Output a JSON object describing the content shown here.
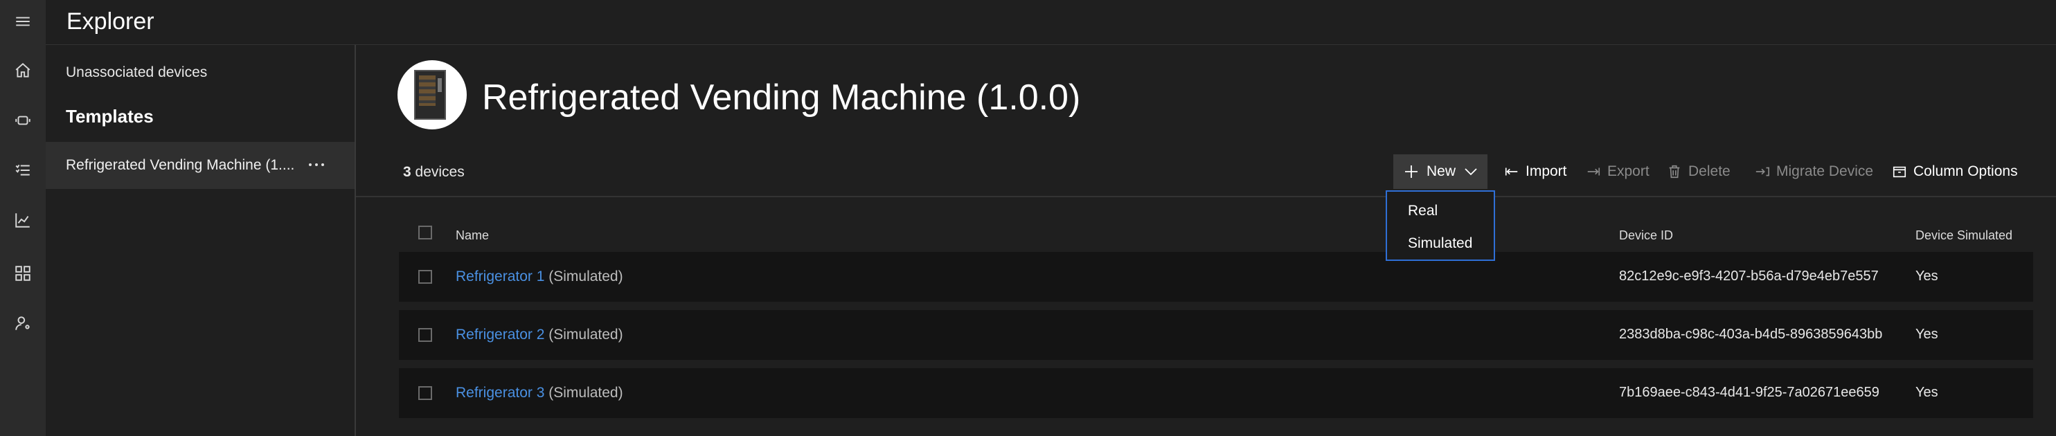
{
  "app": {
    "title": "Explorer"
  },
  "rail": {
    "icons": [
      "menu-icon",
      "home-icon",
      "device-icon",
      "checklist-icon",
      "chart-icon",
      "dashboard-icon",
      "user-settings-icon"
    ]
  },
  "nav": {
    "unassociated_label": "Unassociated devices",
    "templates_heading": "Templates",
    "selected_template": "Refrigerated Vending Machine (1...."
  },
  "header": {
    "title": "Refrigerated Vending Machine (1.0.0)"
  },
  "toolbar": {
    "count": "3",
    "count_suffix": " devices",
    "new_label": "New",
    "import_label": "Import",
    "export_label": "Export",
    "delete_label": "Delete",
    "migrate_label": "Migrate Device",
    "column_options_label": "Column Options"
  },
  "new_menu": {
    "items": [
      "Real",
      "Simulated"
    ]
  },
  "table": {
    "columns": {
      "name": "Name",
      "device_id": "Device ID",
      "simulated": "Device Simulated"
    },
    "rows": [
      {
        "name": "Refrigerator 1",
        "suffix": "(Simulated)",
        "device_id": "82c12e9c-e9f3-4207-b56a-d79e4eb7e557",
        "simulated": "Yes"
      },
      {
        "name": "Refrigerator 2",
        "suffix": "(Simulated)",
        "device_id": "2383d8ba-c98c-403a-b4d5-8963859643bb",
        "simulated": "Yes"
      },
      {
        "name": "Refrigerator 3",
        "suffix": "(Simulated)",
        "device_id": "7b169aee-c843-4d41-9f25-7a02671ee659",
        "simulated": "Yes"
      }
    ]
  },
  "colors": {
    "accent": "#4a90e2",
    "menu_border": "#2f6fd6",
    "background": "#1f1f1f"
  }
}
